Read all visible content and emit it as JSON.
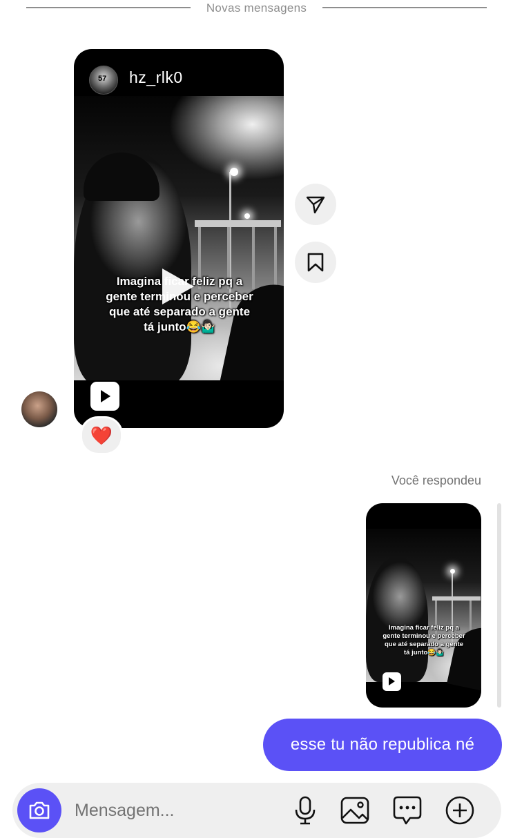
{
  "separator": {
    "label": "Novas mensagens"
  },
  "shared_reel": {
    "username": "hz_rlk0",
    "avatar_badge": "57",
    "caption_lines": [
      "Imagina ficar feliz pq a",
      "gente terminou e perceber",
      "que até separado a gente",
      "tá junto😂🤷🏻‍♂️"
    ]
  },
  "reaction": {
    "emoji": "❤️"
  },
  "reply": {
    "label": "Você respondeu",
    "thumb_caption_lines": [
      "Imagina ficar feliz pq a",
      "gente terminou e perceber",
      "que até separado a gente",
      "tá junto😂🤷🏻‍♂️"
    ]
  },
  "outgoing_message": {
    "text": "esse tu não republica né"
  },
  "composer": {
    "placeholder": "Mensagem..."
  },
  "colors": {
    "accent": "#5b51f6",
    "muted_text": "#737373",
    "surface": "#efefef"
  },
  "icons": {
    "share": "paper-plane-icon",
    "save": "bookmark-icon",
    "camera": "camera-icon",
    "mic": "microphone-icon",
    "gallery": "image-icon",
    "sticker": "chat-bubble-icon",
    "more": "plus-circle-icon"
  }
}
